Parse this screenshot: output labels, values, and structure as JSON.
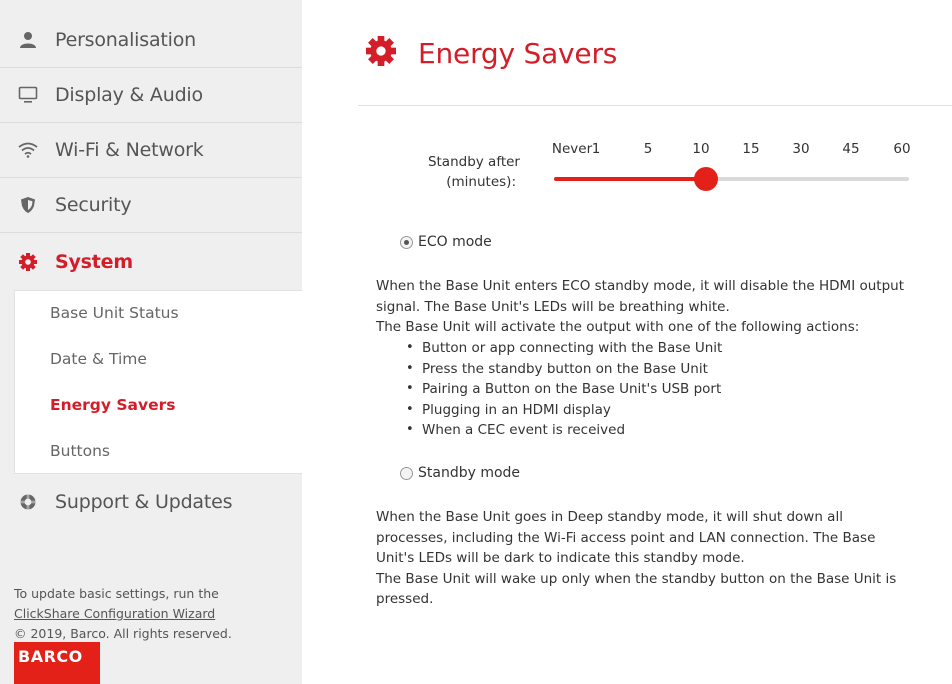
{
  "sidebar": {
    "items": [
      {
        "label": "Personalisation",
        "icon": "user-icon"
      },
      {
        "label": "Display & Audio",
        "icon": "monitor-icon"
      },
      {
        "label": "Wi-Fi & Network",
        "icon": "wifi-icon"
      },
      {
        "label": "Security",
        "icon": "shield-icon"
      },
      {
        "label": "System",
        "icon": "gear-icon"
      }
    ],
    "submenu": [
      "Base Unit Status",
      "Date & Time",
      "Energy Savers",
      "Buttons"
    ],
    "support": {
      "label": "Support & Updates",
      "icon": "lifebuoy-icon"
    },
    "footer": {
      "line1": "To update basic settings, run the",
      "link": "ClickShare Configuration Wizard",
      "copyright": "© 2019, Barco. All rights reserved."
    },
    "logo_text": "BARCO"
  },
  "main": {
    "title": "Energy Savers",
    "slider": {
      "label_line1": "Standby after",
      "label_line2": "(minutes):",
      "ticks": [
        "Never",
        "1",
        "5",
        "10",
        "15",
        "30",
        "45",
        "60"
      ],
      "selected": "10"
    },
    "eco": {
      "label": "ECO mode",
      "checked": true,
      "text1": "When the Base Unit enters ECO standby mode, it will disable the HDMI output signal. The Base Unit's LEDs will be breathing white.",
      "text2": "The Base Unit will activate the output with one of the following actions:",
      "bullets": [
        "Button or app connecting with the Base Unit",
        "Press the standby button on the Base Unit",
        "Pairing a Button on the Base Unit's USB port",
        "Plugging in an HDMI display",
        "When a CEC event is received"
      ]
    },
    "standby": {
      "label": "Standby mode",
      "checked": false,
      "text1": "When the Base Unit goes in Deep standby mode, it will shut down all processes, including the Wi-Fi access point and LAN connection. The Base Unit's LEDs will be dark to indicate this standby mode.",
      "text2": "The Base Unit will wake up only when the standby button on the Base Unit is pressed."
    }
  },
  "colors": {
    "accent": "#d31e2a",
    "sidebar_bg": "#efefef",
    "track": "#d9d9d9"
  }
}
